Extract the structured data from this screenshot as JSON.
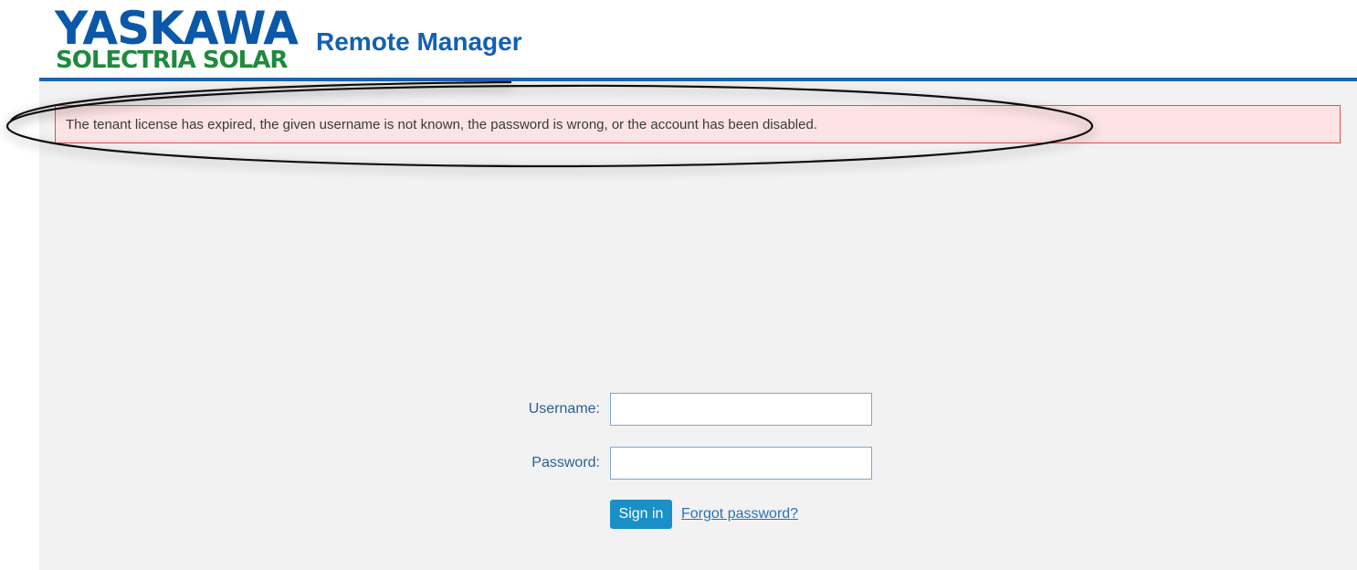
{
  "header": {
    "logo_line1": "YASKAWA",
    "logo_line2": "SOLECTRIA SOLAR",
    "app_title": "Remote Manager"
  },
  "alert": {
    "message": "The tenant license has expired, the given username is not known, the password is wrong, or the account has been disabled."
  },
  "login_form": {
    "username_label": "Username:",
    "username_value": "",
    "password_label": "Password:",
    "password_value": "",
    "signin_label": "Sign in",
    "forgot_label": "Forgot password?"
  },
  "colors": {
    "brand_blue": "#0b58a8",
    "brand_green": "#1f8a3c",
    "header_rule": "#1a64b4",
    "alert_background": "#fde3e3",
    "alert_border": "#d9534f",
    "button_blue": "#1a8fc8"
  }
}
